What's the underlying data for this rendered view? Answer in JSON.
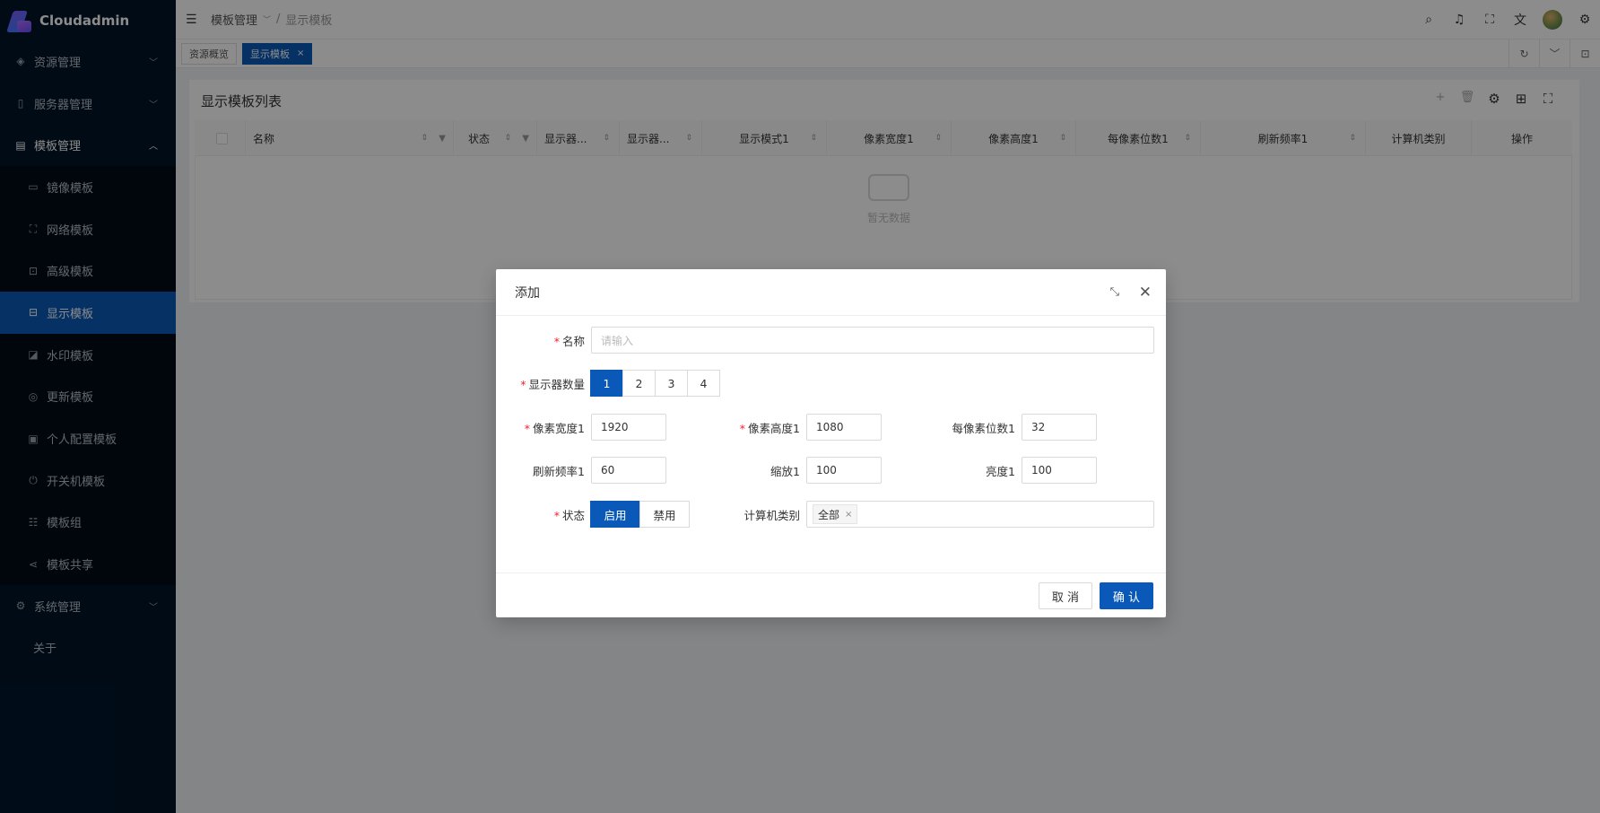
{
  "app": {
    "name": "Cloudadmin"
  },
  "sidebar": {
    "groups": [
      {
        "label": "资源管理",
        "icon": "resource-icon",
        "chevron": "﹀"
      },
      {
        "label": "服务器管理",
        "icon": "server-icon",
        "chevron": "﹀"
      },
      {
        "label": "模板管理",
        "icon": "template-icon",
        "chevron": "︿"
      }
    ],
    "items": [
      {
        "label": "镜像模板",
        "icon": "image-template-icon"
      },
      {
        "label": "网络模板",
        "icon": "network-template-icon"
      },
      {
        "label": "高级模板",
        "icon": "advanced-template-icon"
      },
      {
        "label": "显示模板",
        "icon": "display-template-icon"
      },
      {
        "label": "水印模板",
        "icon": "watermark-template-icon"
      },
      {
        "label": "更新模板",
        "icon": "update-template-icon"
      },
      {
        "label": "个人配置模板",
        "icon": "profile-template-icon"
      },
      {
        "label": "开关机模板",
        "icon": "power-template-icon"
      },
      {
        "label": "模板组",
        "icon": "template-group-icon"
      },
      {
        "label": "模板共享",
        "icon": "share-icon"
      }
    ],
    "system": {
      "label": "系统管理",
      "icon": "settings-icon",
      "chevron": "﹀"
    },
    "about": {
      "label": "关于"
    }
  },
  "header": {
    "breadcrumb": [
      "模板管理",
      "显示模板"
    ],
    "crumb_sep": "/",
    "crumb_caret": "﹀"
  },
  "tabs": [
    {
      "label": "资源概览"
    },
    {
      "label": "显示模板",
      "close": "×"
    }
  ],
  "card": {
    "title": "显示模板列表",
    "columns": [
      "名称",
      "状态",
      "显示器...",
      "显示器...",
      "显示模式1",
      "像素宽度1",
      "像素高度1",
      "每像素位数1",
      "刷新频率1",
      "计算机类别",
      "操作"
    ],
    "empty_text": "暂无数据",
    "add_glyph": "+"
  },
  "modal": {
    "title": "添加",
    "required_mark": "*",
    "name_label": "名称",
    "name_placeholder": "请输入",
    "monitors_label": "显示器数量",
    "monitor_options": [
      "1",
      "2",
      "3",
      "4"
    ],
    "width_label": "像素宽度1",
    "width_value": "1920",
    "height_label": "像素高度1",
    "height_value": "1080",
    "bpp_label": "每像素位数1",
    "bpp_value": "32",
    "refresh_label": "刷新频率1",
    "refresh_value": "60",
    "zoom_label": "缩放1",
    "zoom_value": "100",
    "brightness_label": "亮度1",
    "brightness_value": "100",
    "status_label": "状态",
    "status_on": "启用",
    "status_off": "禁用",
    "category_label": "计算机类别",
    "category_tag": "全部",
    "tag_close": "×",
    "close_glyph": "✕",
    "cancel_label": "取 消",
    "ok_label": "确 认"
  },
  "colors": {
    "primary": "#0a59b8",
    "sidebar_bg": "#001529",
    "submenu_bg": "#000c17",
    "required": "#f5222d"
  }
}
